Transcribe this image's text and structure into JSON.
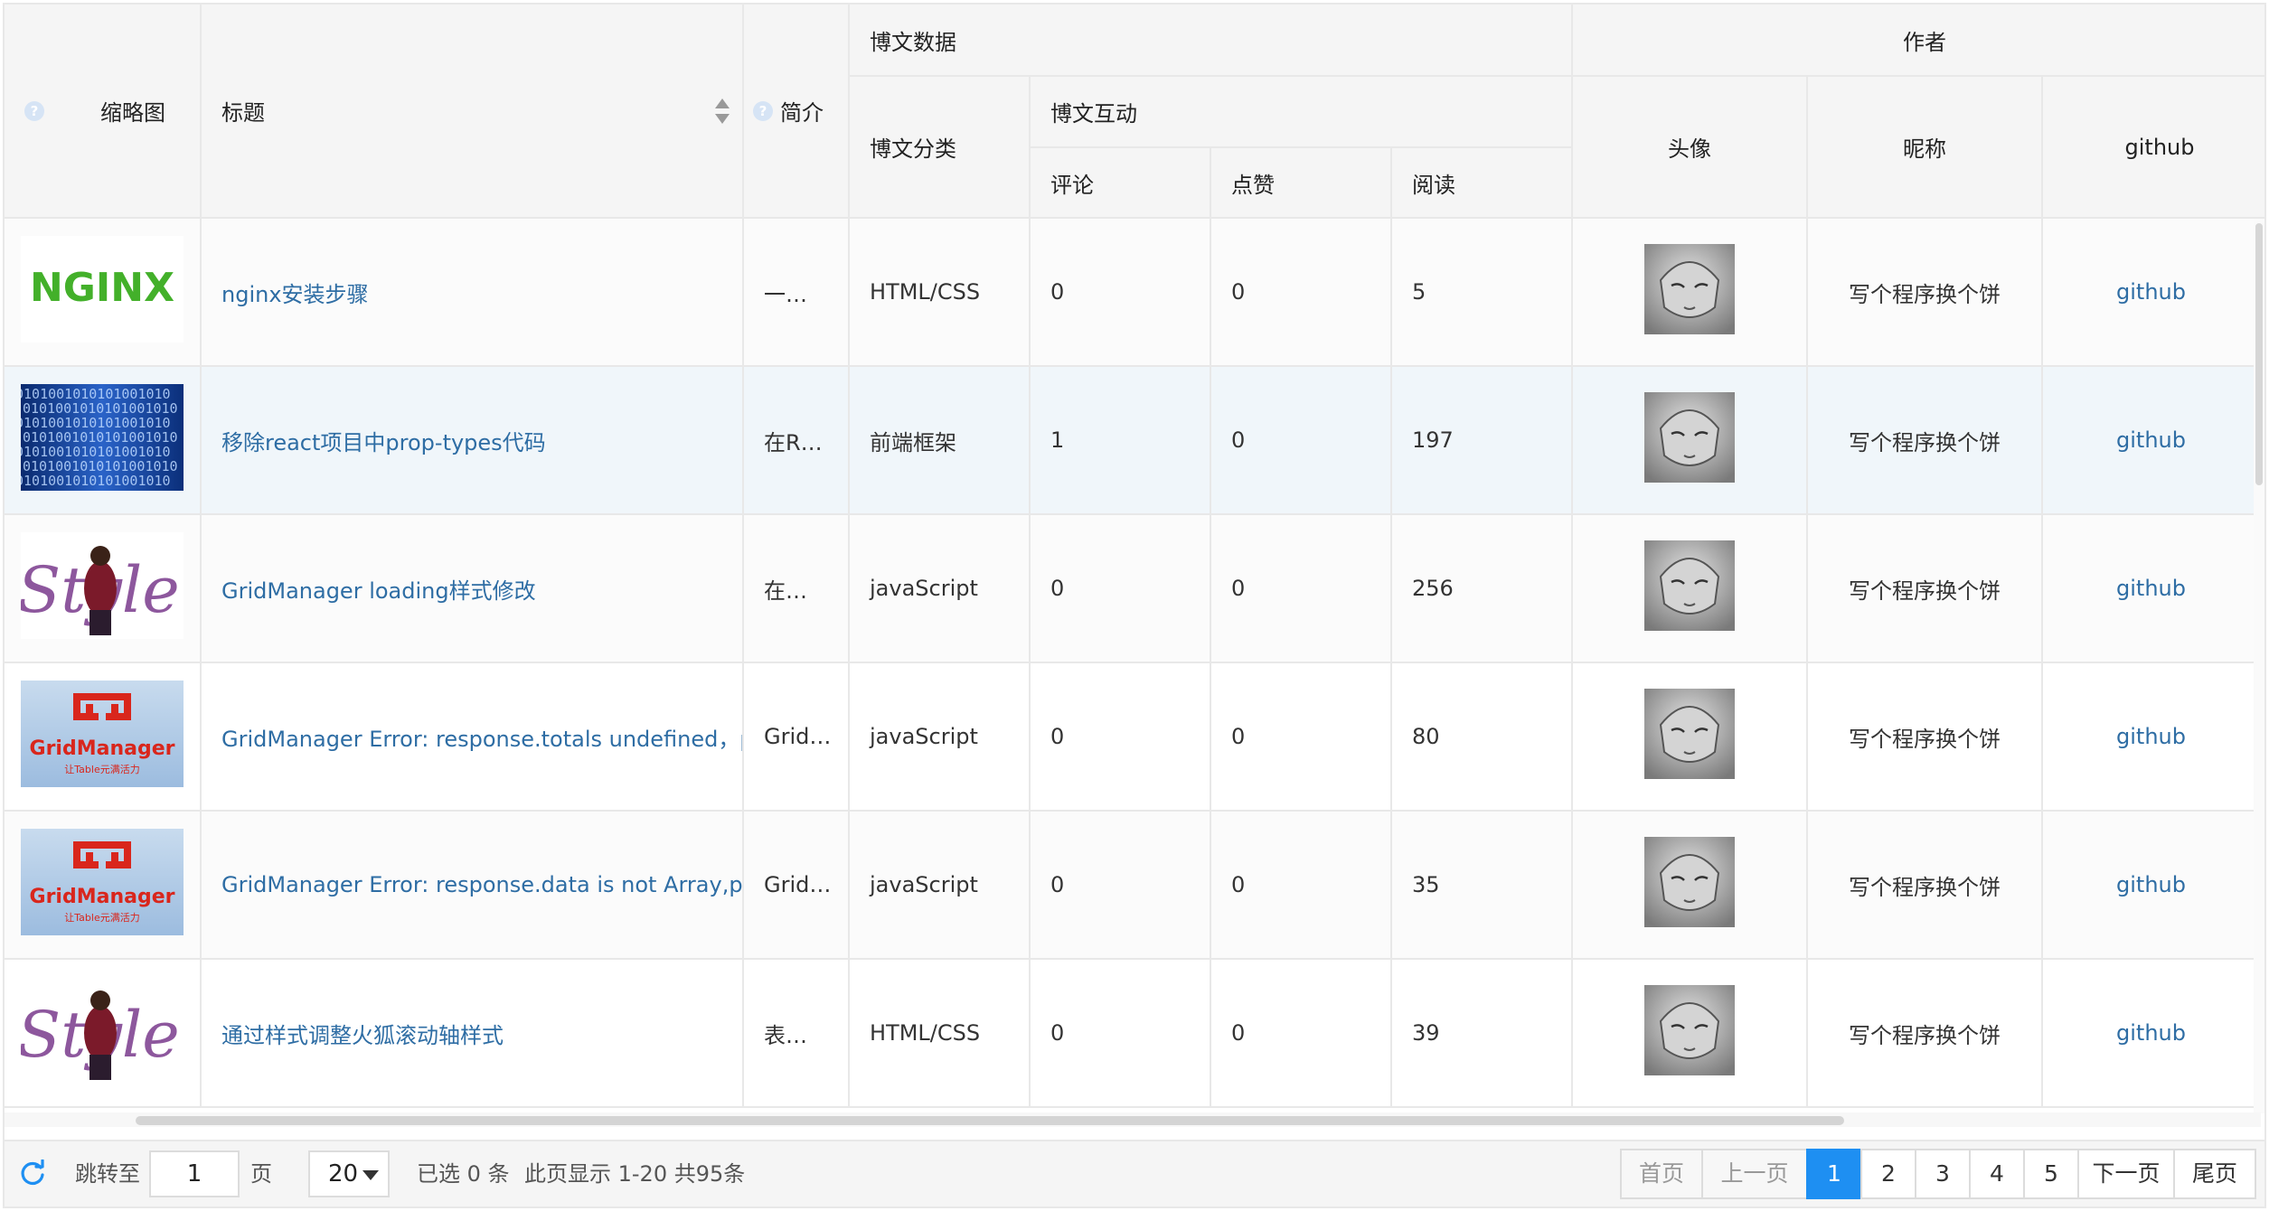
{
  "header": {
    "group_blog": "博文数据",
    "group_author": "作者",
    "thumbnail": "缩略图",
    "title": "标题",
    "summary": "简介",
    "category": "博文分类",
    "interaction": "博文互动",
    "comments": "评论",
    "likes": "点赞",
    "reads": "阅读",
    "avatar": "头像",
    "nickname": "昵称",
    "github": "github"
  },
  "rows": [
    {
      "thumb": "nginx",
      "thumb_text": "NGINX",
      "title": "nginx安装步骤",
      "summary": "一…",
      "category": "HTML/CSS",
      "comments": "0",
      "likes": "0",
      "reads": "5",
      "nickname": "写个程序换个饼",
      "github": "github"
    },
    {
      "thumb": "binary",
      "thumb_text": "",
      "title": "移除react项目中prop-types代码",
      "summary": "在R…",
      "category": "前端框架",
      "comments": "1",
      "likes": "0",
      "reads": "197",
      "nickname": "写个程序换个饼",
      "github": "github"
    },
    {
      "thumb": "style",
      "thumb_text": "Style",
      "title": "GridManager loading样式修改",
      "summary": "在…",
      "category": "javaScript",
      "comments": "0",
      "likes": "0",
      "reads": "256",
      "nickname": "写个程序换个饼",
      "github": "github"
    },
    {
      "thumb": "gridmanager",
      "thumb_text": "GridManager",
      "thumb_subtext": "让Table元满活力",
      "title": "GridManager Error: response.totals undefined，please",
      "summary": "Grid…",
      "category": "javaScript",
      "comments": "0",
      "likes": "0",
      "reads": "80",
      "nickname": "写个程序换个饼",
      "github": "github"
    },
    {
      "thumb": "gridmanager",
      "thumb_text": "GridManager",
      "thumb_subtext": "让Table元满活力",
      "title": "GridManager Error: response.data is not Array,please",
      "summary": "Grid…",
      "category": "javaScript",
      "comments": "0",
      "likes": "0",
      "reads": "35",
      "nickname": "写个程序换个饼",
      "github": "github"
    },
    {
      "thumb": "style",
      "thumb_text": "Style",
      "title": "通过样式调整火狐滚动轴样式",
      "summary": "表…",
      "category": "HTML/CSS",
      "comments": "0",
      "likes": "0",
      "reads": "39",
      "nickname": "写个程序换个饼",
      "github": "github"
    }
  ],
  "footer": {
    "refresh_icon": "refresh-icon",
    "goto_label": "跳转至",
    "current_page": "1",
    "page_unit": "页",
    "page_size": "20",
    "selected_text": "已选 0 条",
    "range_text": "此页显示 1-20 共95条",
    "first": "首页",
    "prev": "上一页",
    "pages": [
      "1",
      "2",
      "3",
      "4",
      "5"
    ],
    "active_page": "1",
    "next": "下一页",
    "last": "尾页"
  },
  "colors": {
    "link": "#2e6da4",
    "active_page": "#1e8ff2",
    "header_bg": "#f5f5f5",
    "hover_row": "#f0f6fa"
  }
}
